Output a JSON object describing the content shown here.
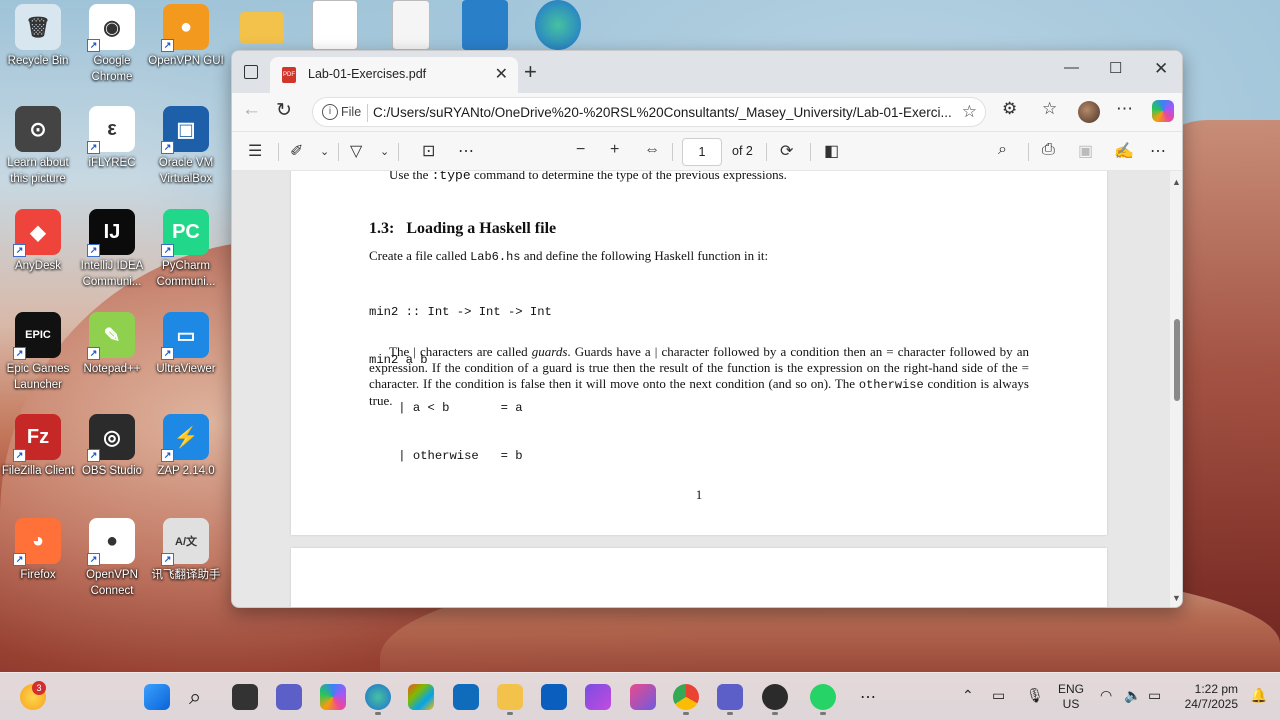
{
  "desktop": {
    "icons": [
      {
        "label": "Recycle Bin",
        "color": "#d8e6f0",
        "glyph": "🗑"
      },
      {
        "label": "Google Chrome",
        "color": "#ffffff",
        "glyph": "◉"
      },
      {
        "label": "OpenVPN GUI",
        "color": "#f39a1e",
        "glyph": "●"
      },
      {
        "label": "Learn about this picture",
        "color": "#444444",
        "glyph": "⊙"
      },
      {
        "label": "iFLYREC",
        "color": "#ffffff",
        "glyph": "ε"
      },
      {
        "label": "Oracle VM VirtualBox",
        "color": "#1d5fa8",
        "glyph": "▣"
      },
      {
        "label": "AnyDesk",
        "color": "#ef443b",
        "glyph": "◆"
      },
      {
        "label": "IntelliJ IDEA Communi...",
        "color": "#0b0b0b",
        "glyph": "IJ"
      },
      {
        "label": "PyCharm Communi...",
        "color": "#21d789",
        "glyph": "PC"
      },
      {
        "label": "Epic Games Launcher",
        "color": "#111111",
        "glyph": "EPIC"
      },
      {
        "label": "Notepad++",
        "color": "#8fd14f",
        "glyph": "✎"
      },
      {
        "label": "UltraViewer",
        "color": "#1e88e5",
        "glyph": "▭"
      },
      {
        "label": "FileZilla Client",
        "color": "#c62828",
        "glyph": "Fz"
      },
      {
        "label": "OBS Studio",
        "color": "#2b2b2b",
        "glyph": "◎"
      },
      {
        "label": "ZAP 2.14.0",
        "color": "#1e88e5",
        "glyph": "⚡"
      },
      {
        "label": "Firefox",
        "color": "#ff7139",
        "glyph": "◕"
      },
      {
        "label": "OpenVPN Connect",
        "color": "#ffffff",
        "glyph": "●"
      },
      {
        "label": "讯飞翻译助手",
        "color": "#e0e0e0",
        "glyph": "A/文"
      }
    ]
  },
  "browser": {
    "tab_title": "Lab-01-Exercises.pdf",
    "file_label": "File",
    "url": "C:/Users/suRYANto/OneDrive%20-%20RSL%20Consultants/_Masey_University/Lab-01-Exerci...",
    "page_number": "1",
    "page_total": "of 2"
  },
  "document": {
    "prev_line_a": "Use the ",
    "prev_line_code": ":type",
    "prev_line_b": " command to determine the type of the previous expressions.",
    "section_number": "1.3:",
    "section_title": "Loading a Haskell file",
    "intro_a": "Create a file called ",
    "intro_code": "Lab6.hs",
    "intro_b": " and define the following Haskell function in it:",
    "code_lines": [
      "min2 :: Int -> Int -> Int",
      "min2 a b",
      "    | a < b       = a",
      "    | otherwise   = b"
    ],
    "para_1": "The | characters are called ",
    "para_guards": "guards",
    "para_2": ". Guards have a | character followed by a condition then an = character followed by an expression. If the condition of a guard is true then the result of the function is the expression on the right-hand side of the = character. If the condition is false then it will move onto the next condition (and so on). The ",
    "para_code": "otherwise",
    "para_3": " condition is always true.",
    "page_footer": "1"
  },
  "taskbar": {
    "weather_badge": "3",
    "lang_1": "ENG",
    "lang_2": "US",
    "time": "1:22 pm",
    "date": "24/7/2025"
  }
}
